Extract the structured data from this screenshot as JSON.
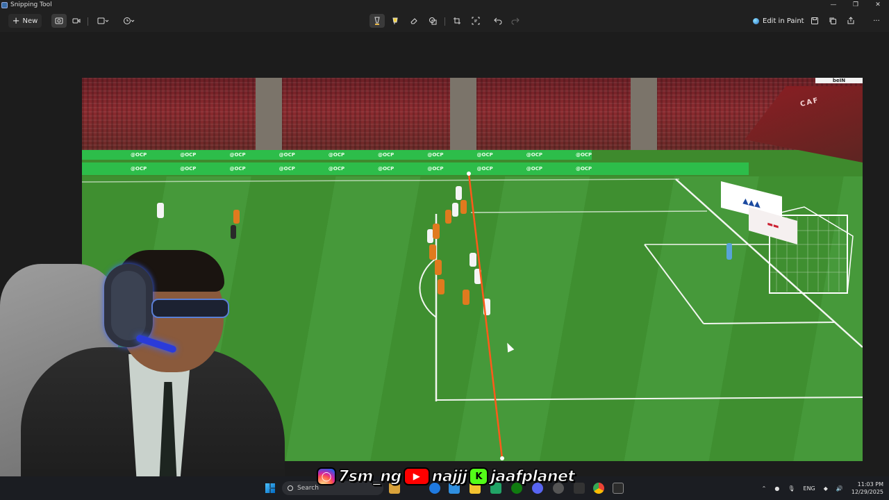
{
  "window": {
    "title": "Snipping Tool",
    "controls": [
      "minimize",
      "restore",
      "close"
    ]
  },
  "toolbar": {
    "new_label": "New",
    "capture_modes": [
      "screenshot-icon",
      "video-icon"
    ],
    "shape_dropdown": "rectangle-icon",
    "delay_dropdown": "timer-icon",
    "tools": [
      "pen-icon",
      "highlighter-icon",
      "eraser-icon",
      "shapes-icon",
      "crop-icon",
      "text-actions-icon",
      "undo-icon",
      "redo-icon"
    ],
    "edit_in_paint_label": "Edit in Paint",
    "actions": [
      "save-icon",
      "copy-icon",
      "share-icon",
      "more-icon"
    ]
  },
  "capture": {
    "scoreboard": "beIN",
    "sponsor_text": "@OCP",
    "stand_text": "CAF",
    "annotation_color": "#ff5a1a"
  },
  "overlay": {
    "instagram_handle": "7sm_ng",
    "youtube_handle": "najjj",
    "kick_handle": "jaafplanet"
  },
  "taskbar": {
    "search_placeholder": "Search",
    "language": "ENG",
    "time": "11:03 PM",
    "date": "12/29/2025"
  },
  "colors": {
    "app_bg": "#202020",
    "accent": "#e8b84a",
    "pitch": "#3f8f30",
    "board": "#2dbd4a"
  }
}
